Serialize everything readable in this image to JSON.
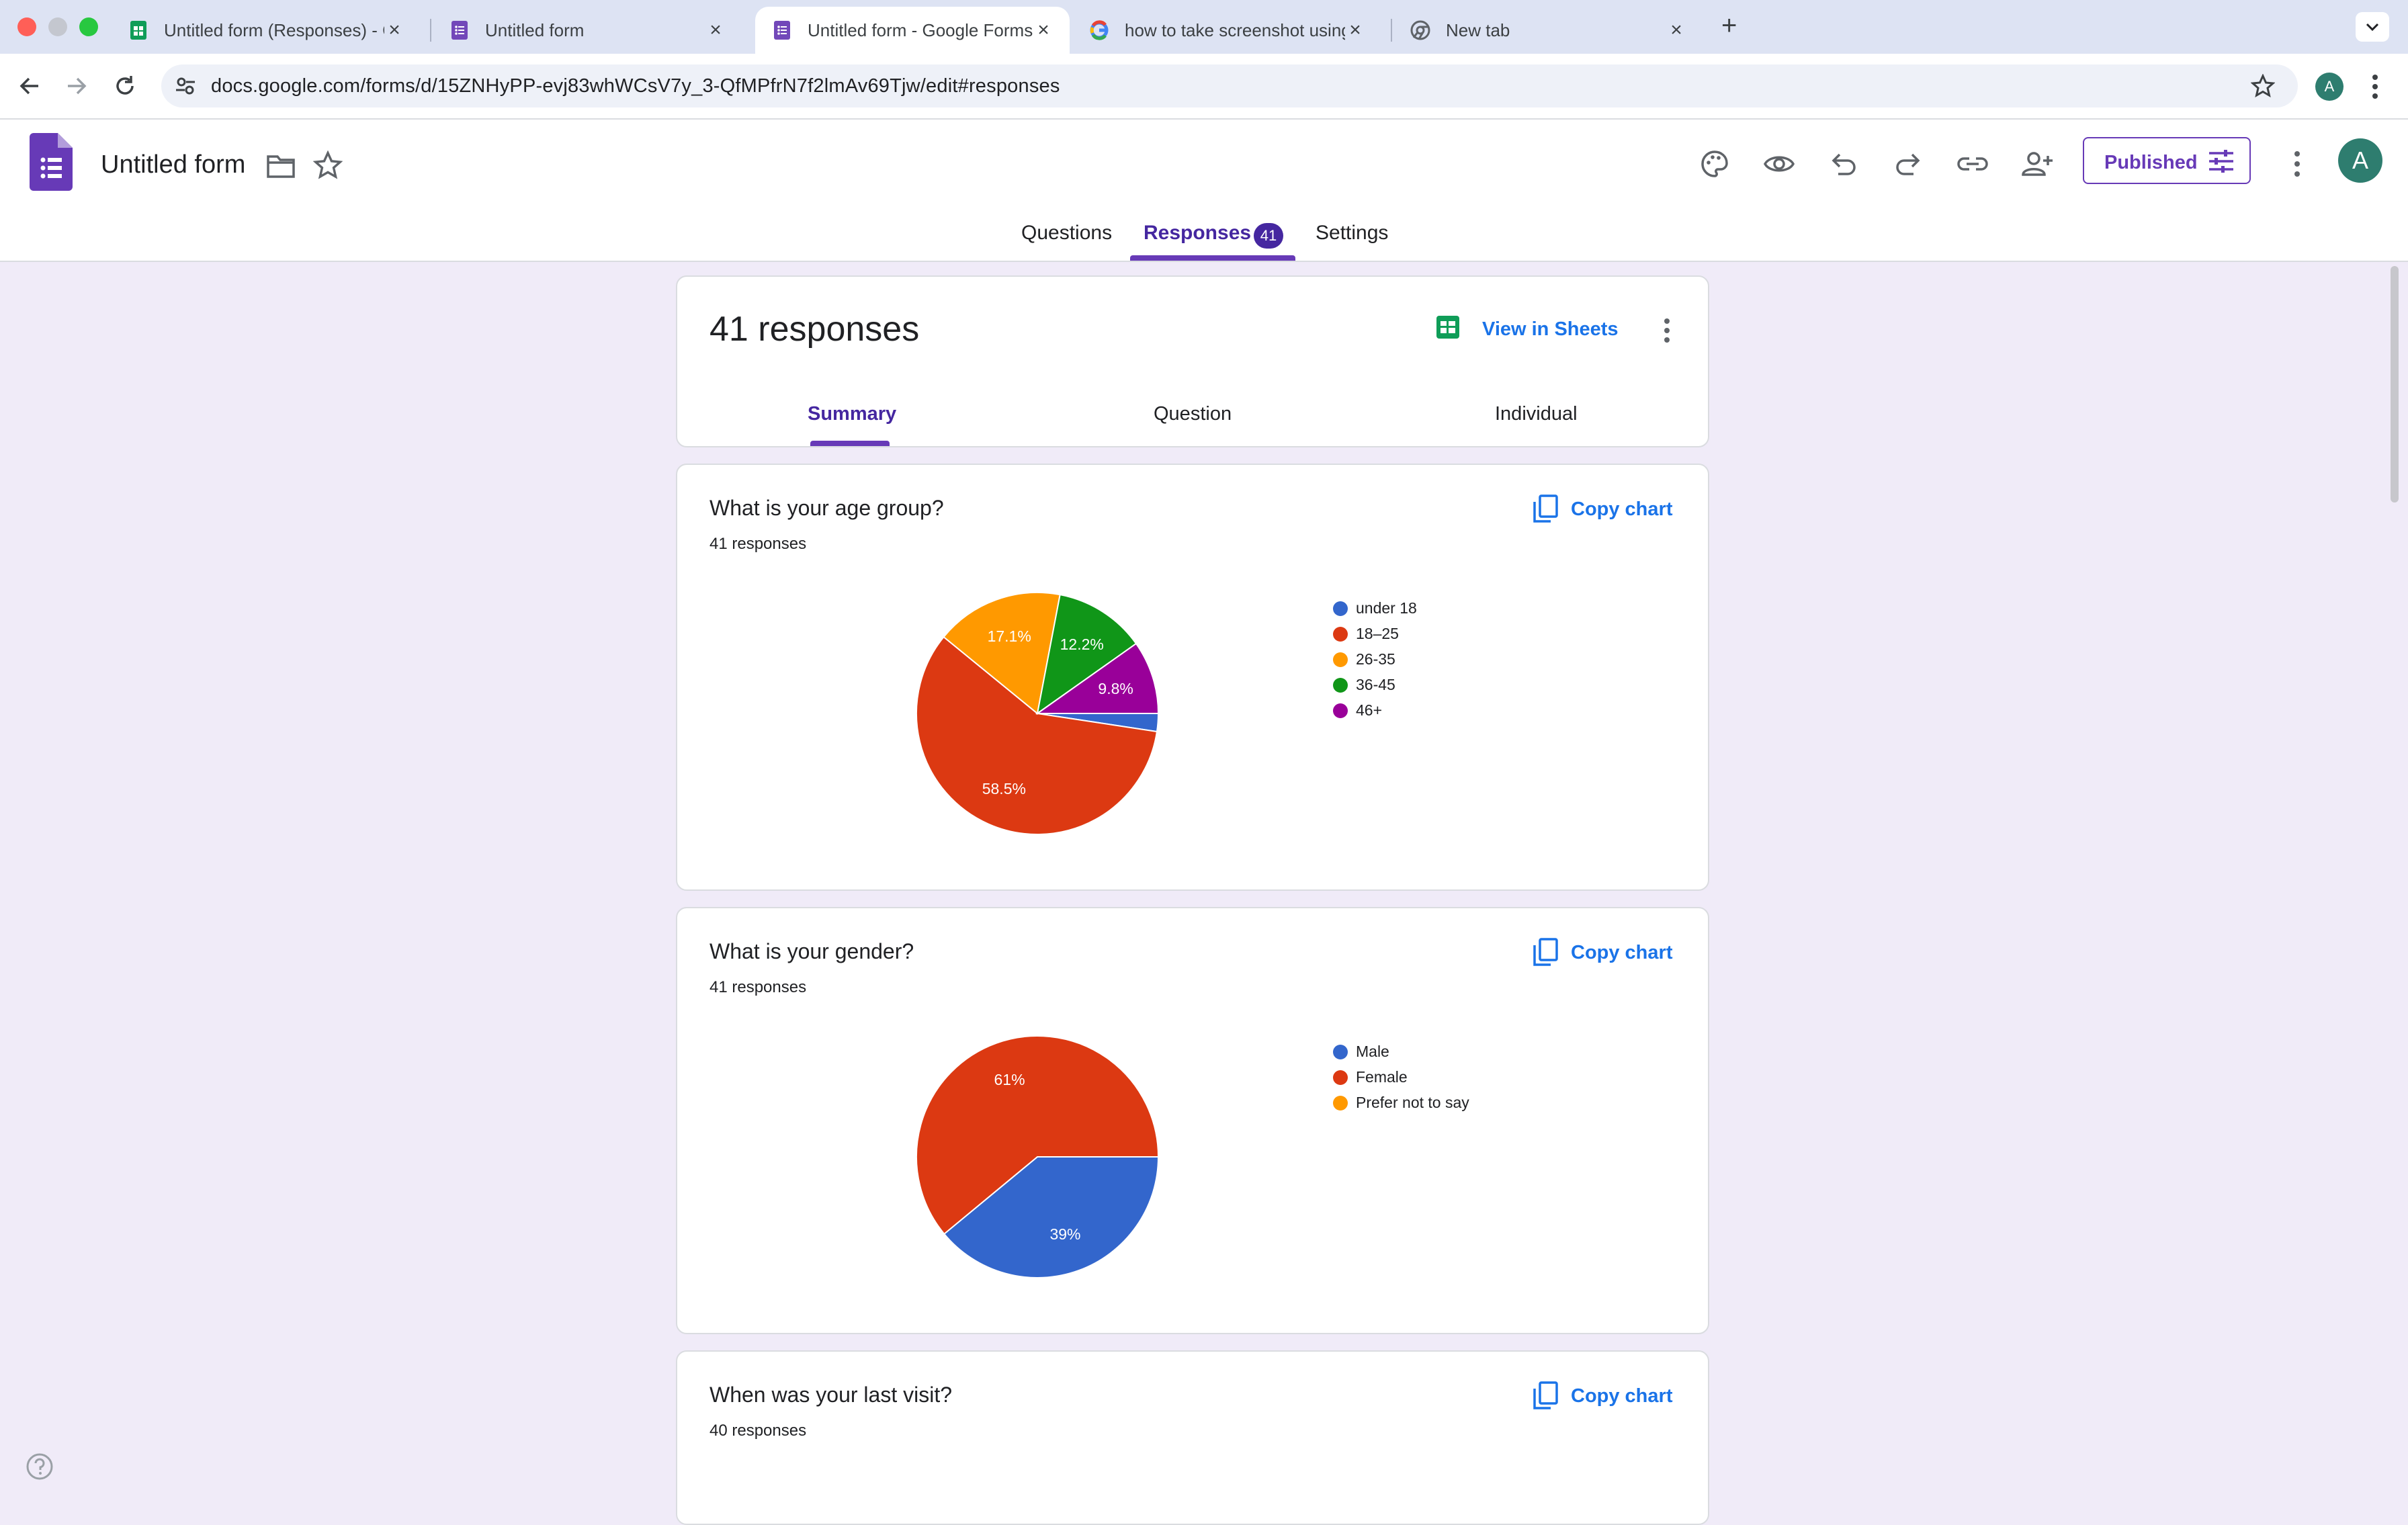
{
  "browser": {
    "tabs": [
      {
        "title": "Untitled form (Responses) - G",
        "icon": "sheets-icon",
        "active": false
      },
      {
        "title": "Untitled form",
        "icon": "forms-icon",
        "active": false
      },
      {
        "title": "Untitled form - Google Forms",
        "icon": "forms-icon",
        "active": true
      },
      {
        "title": "how to take screenshot using",
        "icon": "google-icon",
        "active": false
      },
      {
        "title": "New tab",
        "icon": "chrome-icon",
        "active": false
      }
    ],
    "new_tab_label": "+",
    "url": "docs.google.com/forms/d/15ZNHyPP-evj83whWCsV7y_3-QfMPfrN7f2lmAv69Tjw/edit#responses",
    "profile_initial": "A"
  },
  "header": {
    "form_title": "Untitled form",
    "published_label": "Published",
    "avatar_initial": "A",
    "tabs": {
      "questions": "Questions",
      "responses": "Responses",
      "responses_badge": "41",
      "settings": "Settings"
    }
  },
  "summary_card": {
    "heading": "41 responses",
    "view_in_sheets": "View in Sheets",
    "subtabs": [
      "Summary",
      "Question",
      "Individual"
    ],
    "active_subtab": "Summary"
  },
  "questions": [
    {
      "title": "What is your age group?",
      "count": "41 responses",
      "copy_label": "Copy chart",
      "chart_data": {
        "type": "pie",
        "categories": [
          "under 18",
          "18–25",
          "26-35",
          "36-45",
          "46+"
        ],
        "values": [
          2.4,
          58.5,
          17.1,
          12.2,
          9.8
        ],
        "slice_labels": [
          "",
          "58.5%",
          "17.1%",
          "12.2%",
          "9.8%"
        ],
        "colors": [
          "#3366cc",
          "#dc3912",
          "#ff9900",
          "#109618",
          "#990099"
        ],
        "legend_position": "right"
      }
    },
    {
      "title": "What is your gender?",
      "count": "41 responses",
      "copy_label": "Copy chart",
      "chart_data": {
        "type": "pie",
        "categories": [
          "Male",
          "Female",
          "Prefer not to say"
        ],
        "values": [
          39,
          61,
          0
        ],
        "slice_labels": [
          "39%",
          "61%",
          ""
        ],
        "colors": [
          "#3366cc",
          "#dc3912",
          "#ff9900"
        ],
        "legend_position": "right"
      }
    },
    {
      "title": "When was your last visit?",
      "count": "40 responses",
      "copy_label": "Copy chart"
    }
  ],
  "colors": {
    "page_bg": "#f0ebf8",
    "accent": "#673ab7",
    "link": "#1a73e8"
  }
}
